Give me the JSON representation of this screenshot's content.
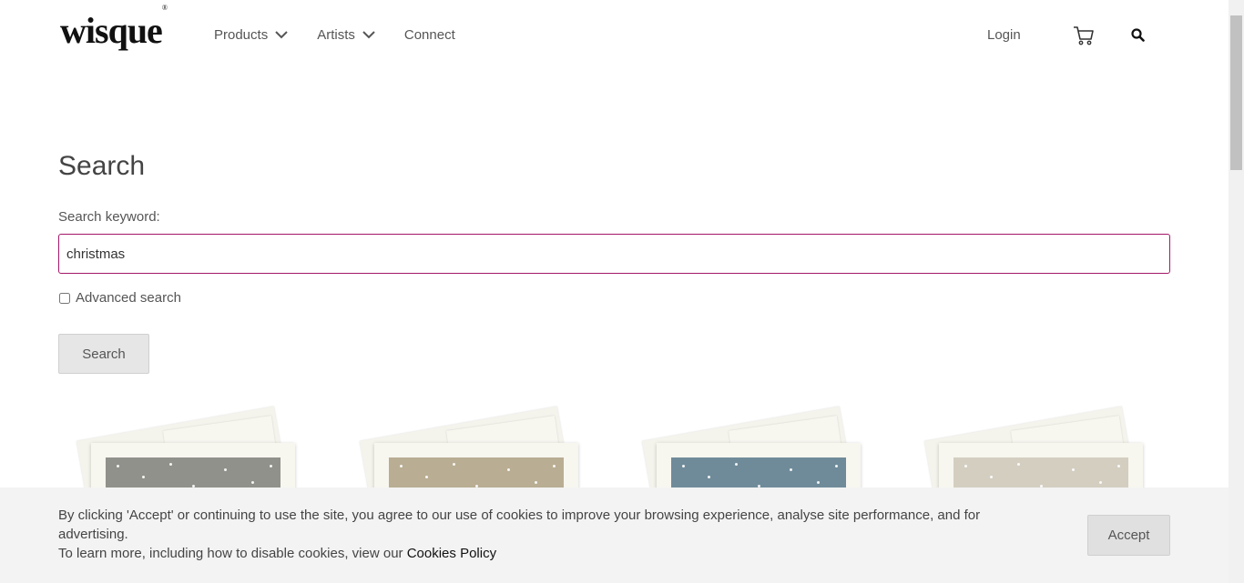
{
  "header": {
    "logo": "wisque",
    "nav": [
      {
        "label": "Products",
        "has_dropdown": true
      },
      {
        "label": "Artists",
        "has_dropdown": true
      },
      {
        "label": "Connect",
        "has_dropdown": false
      }
    ],
    "login_label": "Login",
    "icons": [
      "cart-icon",
      "search-icon",
      "chevron-down-icon"
    ]
  },
  "search": {
    "title": "Search",
    "keyword_label": "Search keyword:",
    "keyword_value": "christmas",
    "advanced_label": "Advanced search",
    "advanced_checked": false,
    "button_label": "Search"
  },
  "products": [
    {
      "art_color": "#8f918a"
    },
    {
      "art_color": "#b9ad93"
    },
    {
      "art_color": "#6f8b9a"
    },
    {
      "art_color": "#d3cec0"
    }
  ],
  "cookie": {
    "text_line1": "By clicking 'Accept' or continuing to use the site, you agree to our use of cookies to improve your browsing experience, analyse site performance, and for advertising.",
    "text_line2_prefix": "To learn more, including how to disable cookies, view our ",
    "policy_link": "Cookies Policy",
    "accept_label": "Accept"
  },
  "colors": {
    "accent": "#a31768",
    "banner_bg": "#f3f3f3"
  }
}
